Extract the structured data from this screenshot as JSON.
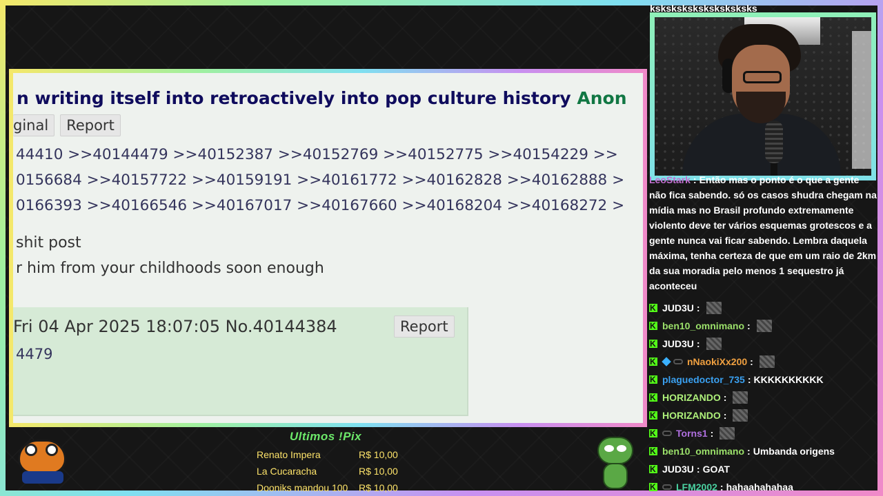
{
  "thread": {
    "title_text": "n writing itself into retroactively into pop culture history",
    "title_author": "Anon",
    "actions": [
      "ginal",
      "Report"
    ],
    "reply_lines": [
      "44410 >>40144479 >>40152387 >>40152769 >>40152775 >>40154229 >>",
      "0156684 >>40157722 >>40159191 >>40161772 >>40162828 >>40162888 >",
      "0166393 >>40166546 >>40167017 >>40167660 >>40168204 >>40168272 >"
    ],
    "body_lines": [
      "shit post",
      "r him from your childhoods soon enough"
    ]
  },
  "reply_post": {
    "info": "Fri 04 Apr 2025 18:07:05 No.40144384",
    "report_label": "Report",
    "text": "4479"
  },
  "webcam": {
    "title": "ksksksksksksksksksks"
  },
  "chat": {
    "first_message": {
      "name": "LeoStark",
      "text": "Então mas o ponto é o que a gente não fica sabendo. só os casos shudra chegam na mídia mas no Brasil profundo extremamente violento deve ter vários esquemas grotescos e a gente nunca vai ficar sabendo. Lembra daquela máxima, tenha certeza de que em um raio de 2km da sua moradia pelo menos 1 sequestro já aconteceu"
    },
    "messages": [
      {
        "name": "JUD3U",
        "color": "#ffffff",
        "text": "",
        "emote": true
      },
      {
        "name": "ben10_omnimano",
        "color": "#9be06a",
        "text": "",
        "emote": true
      },
      {
        "name": "JUD3U",
        "color": "#ffffff",
        "text": "",
        "emote": true
      },
      {
        "name": "nNaokiXx200",
        "color": "#f0a040",
        "text": "",
        "emote": true
      },
      {
        "name": "plaguedoctor_735",
        "color": "#3aa0f0",
        "text": "KKKKKKKKKK",
        "emote": false
      },
      {
        "name": "HORIZANDO",
        "color": "#aef07a",
        "text": "",
        "emote": true
      },
      {
        "name": "HORIZANDO",
        "color": "#aef07a",
        "text": "",
        "emote": true
      },
      {
        "name": "Torns1",
        "color": "#b070e0",
        "text": "",
        "emote": true
      },
      {
        "name": "ben10_omnimano",
        "color": "#9be06a",
        "text": "Umbanda origens",
        "emote": false
      },
      {
        "name": "JUD3U",
        "color": "#ffffff",
        "text": "GOAT",
        "emote": false
      },
      {
        "name": "LFM2002",
        "color": "#4ad0a0",
        "text": "hahaahahahaa",
        "emote": false
      }
    ]
  },
  "pix": {
    "title": "Ultimos !Pix",
    "donations": [
      {
        "name": "Renato Impera",
        "amount": "R$ 10,00"
      },
      {
        "name": "La Cucaracha",
        "amount": "R$ 10,00"
      },
      {
        "name": "Dooniks mandou 100",
        "amount": "R$ 10,00"
      }
    ]
  }
}
